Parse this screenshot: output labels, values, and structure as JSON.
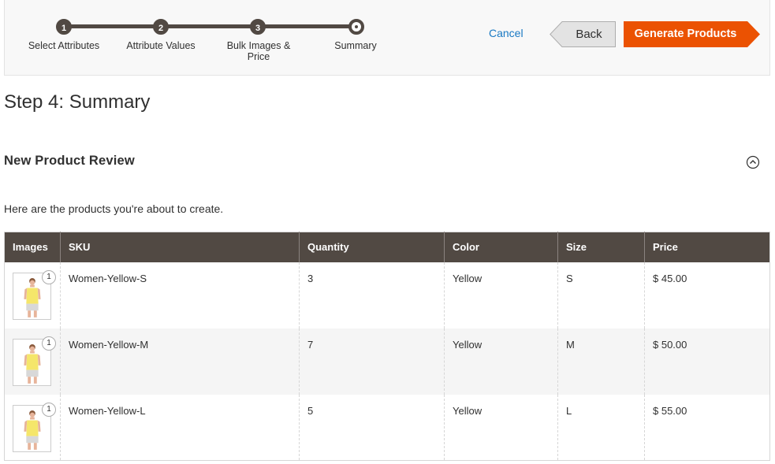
{
  "wizard": {
    "steps": [
      {
        "number": "1",
        "label": "Select Attributes"
      },
      {
        "number": "2",
        "label": "Attribute Values"
      },
      {
        "number": "3",
        "label": "Bulk Images & Price"
      },
      {
        "number": "",
        "label": "Summary"
      }
    ],
    "current_step": 4,
    "cancel_label": "Cancel",
    "back_label": "Back",
    "generate_label": "Generate Products"
  },
  "page_title": "Step 4: Summary",
  "section": {
    "title": "New Product Review",
    "intro": "Here are the products you're about to create."
  },
  "table": {
    "headers": [
      "Images",
      "SKU",
      "Quantity",
      "Color",
      "Size",
      "Price"
    ],
    "rows": [
      {
        "image_count": "1",
        "sku": "Women-Yellow-S",
        "quantity": "3",
        "color": "Yellow",
        "size": "S",
        "price": "$ 45.00"
      },
      {
        "image_count": "1",
        "sku": "Women-Yellow-M",
        "quantity": "7",
        "color": "Yellow",
        "size": "M",
        "price": "$ 50.00"
      },
      {
        "image_count": "1",
        "sku": "Women-Yellow-L",
        "quantity": "5",
        "color": "Yellow",
        "size": "L",
        "price": "$ 55.00"
      }
    ]
  },
  "colors": {
    "header_bg": "#514943",
    "accent_orange": "#eb5202",
    "link_blue": "#1979c3"
  },
  "icons": {
    "collapse": "chevron-up-circle-icon",
    "thumbnail": "product-image-thumbnail"
  }
}
